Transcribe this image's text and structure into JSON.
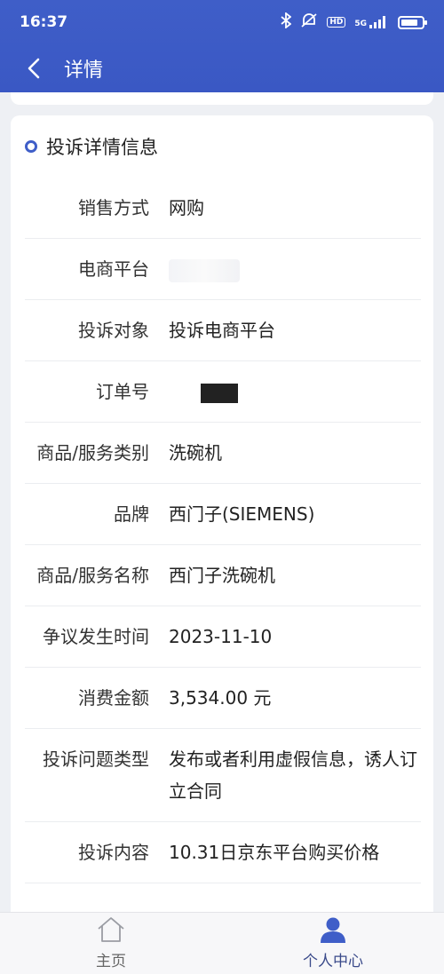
{
  "status": {
    "time": "16:37",
    "network": "5G",
    "hd": "HD"
  },
  "nav": {
    "title": "详情"
  },
  "section": {
    "title": "投诉详情信息"
  },
  "rows": [
    {
      "label": "销售方式",
      "value": "网购"
    },
    {
      "label": "电商平台",
      "value": ""
    },
    {
      "label": "投诉对象",
      "value": "投诉电商平台"
    },
    {
      "label": "订单号",
      "value": ""
    },
    {
      "label": "商品/服务类别",
      "value": "洗碗机"
    },
    {
      "label": "品牌",
      "value": "西门子(SIEMENS)"
    },
    {
      "label": "商品/服务名称",
      "value": "西门子洗碗机"
    },
    {
      "label": "争议发生时间",
      "value": "2023-11-10"
    },
    {
      "label": "消费金额",
      "value": "3,534.00 元"
    },
    {
      "label": "投诉问题类型",
      "value": "发布或者利用虚假信息，诱人订立合同"
    },
    {
      "label": "投诉内容",
      "value": "10.31日京东平台购买价格"
    }
  ],
  "tabs": {
    "home": "主页",
    "me": "个人中心"
  },
  "colors": {
    "primary": "#3f5ec8",
    "active_tab": "#3a4a8a"
  }
}
